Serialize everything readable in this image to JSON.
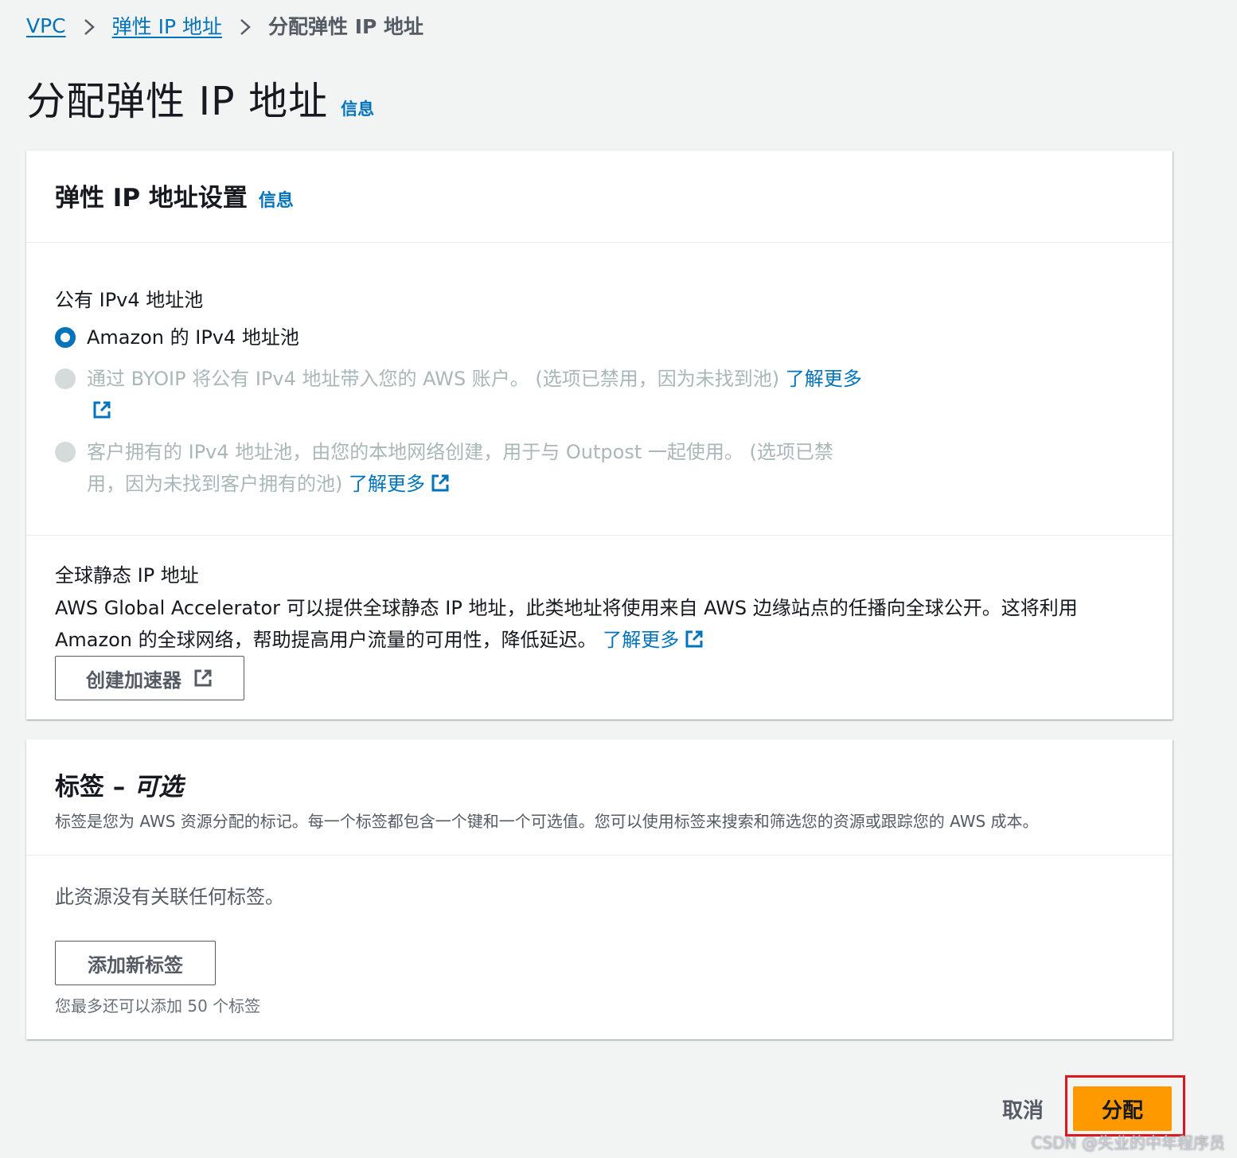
{
  "breadcrumb": {
    "vpc": "VPC",
    "eip": "弹性 IP 地址",
    "current": "分配弹性 IP 地址"
  },
  "page": {
    "title": "分配弹性 IP 地址",
    "info": "信息"
  },
  "settings_panel": {
    "title": "弹性 IP 地址设置",
    "info": "信息",
    "pool_label": "公有 IPv4 地址池",
    "options": [
      {
        "text": "Amazon 的 IPv4 地址池",
        "link": "",
        "selected": true,
        "disabled": false
      },
      {
        "text": "通过 BYOIP 将公有 IPv4 地址带入您的 AWS 账户。 (选项已禁用，因为未找到池) ",
        "link": "了解更多",
        "selected": false,
        "disabled": true
      },
      {
        "text": "客户拥有的 IPv4 地址池，由您的本地网络创建，用于与 Outpost 一起使用。 (选项已禁用，因为未找到客户拥有的池) ",
        "link": "了解更多",
        "selected": false,
        "disabled": true
      }
    ],
    "global_label": "全球静态 IP 地址",
    "global_desc": "AWS Global Accelerator 可以提供全球静态 IP 地址，此类地址将使用来自 AWS 边缘站点的任播向全球公开。这将利用 Amazon 的全球网络，帮助提高用户流量的可用性，降低延迟。 ",
    "global_link": "了解更多",
    "create_accelerator": "创建加速器"
  },
  "tags_panel": {
    "title": "标签",
    "dash": " – ",
    "optional": "可选",
    "subtitle": "标签是您为 AWS 资源分配的标记。每一个标签都包含一个键和一个可选值。您可以使用标签来搜索和筛选您的资源或跟踪您的 AWS 成本。",
    "empty": "此资源没有关联任何标签。",
    "add_tag": "添加新标签",
    "hint": "您最多还可以添加 50 个标签"
  },
  "footer": {
    "cancel": "取消",
    "allocate": "分配"
  },
  "watermark": "CSDN @失业的中年程序员",
  "colors": {
    "link": "#0073bb",
    "primary_button": "#ff9900",
    "highlight_box": "#e0161f",
    "background": "#f2f3f3"
  }
}
